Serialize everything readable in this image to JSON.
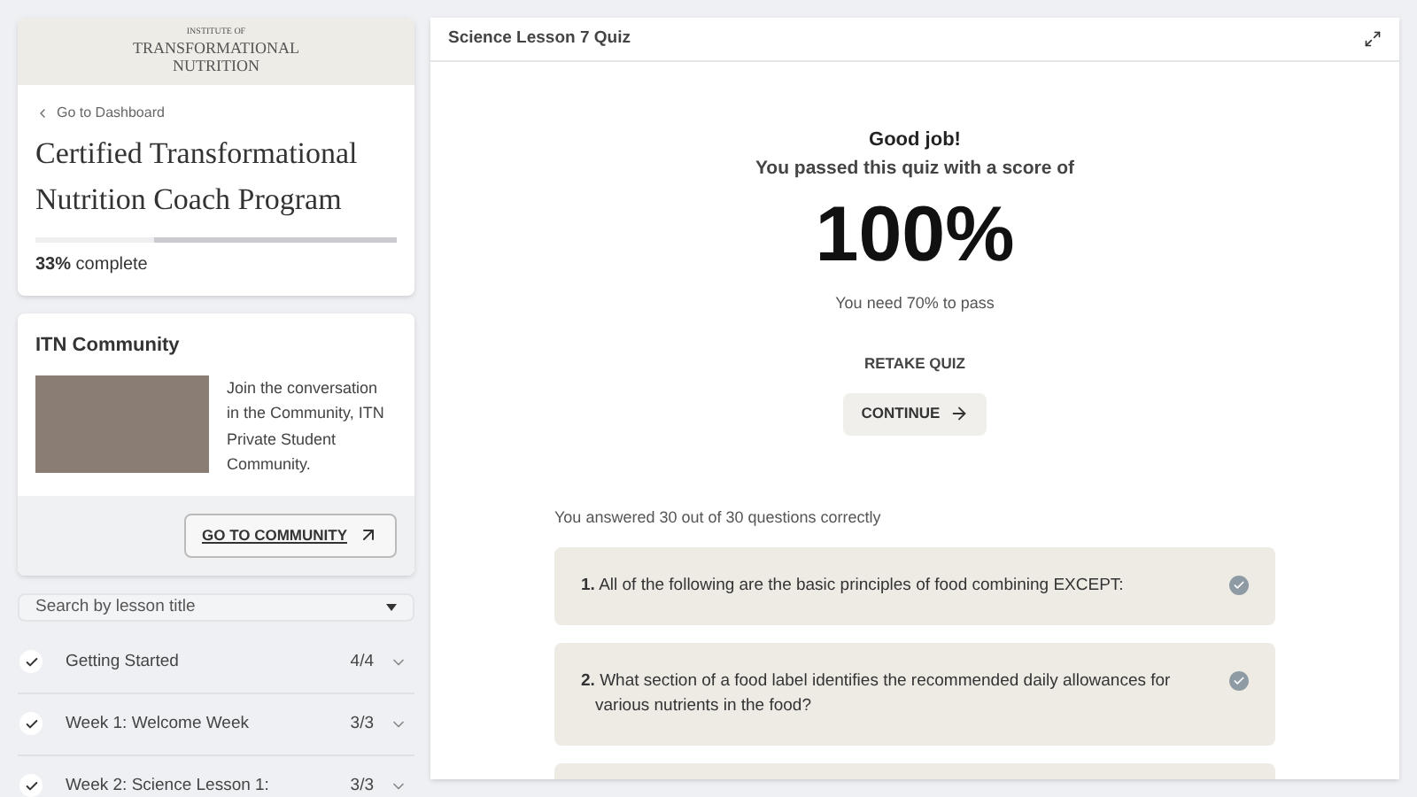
{
  "logo": {
    "small": "INSTITUTE OF",
    "line1": "TRANSFORMATIONAL",
    "line2": "NUTRITION"
  },
  "back_link": "Go to Dashboard",
  "course": {
    "title": "Certified Transformational Nutrition Coach Program",
    "level": 0.33,
    "percent": "33%",
    "suffix": "complete"
  },
  "community": {
    "title": "ITN Community",
    "text": "Join the conversation in the Community, ITN Private Student Community.",
    "button": "GO TO COMMUNITY"
  },
  "search": {
    "placeholder": "Search by lesson title"
  },
  "lessons": [
    {
      "title": "Getting Started",
      "count": "4/4",
      "checked": true
    },
    {
      "title": "Week 1: Welcome Week",
      "count": "3/3",
      "checked": true
    },
    {
      "title": "Week 2: Science Lesson 1:",
      "count": "3/3",
      "checked": true
    }
  ],
  "quiz": {
    "title": "Science Lesson 7 Quiz",
    "heading": "Good job!",
    "subheading": "You passed this quiz with a score of",
    "score": "100%",
    "pass_note": "You need 70% to pass",
    "retake": "RETAKE QUIZ",
    "continue": "CONTINUE",
    "summary": "You answered 30 out of 30 questions correctly",
    "questions": [
      {
        "number": "1.",
        "text": "All of the following are the basic principles of food combining EXCEPT:",
        "correct": true
      },
      {
        "number": "2.",
        "text": "What section of a food label identifies the recommended daily allowances for various nutrients in the food?",
        "correct": true
      }
    ]
  }
}
